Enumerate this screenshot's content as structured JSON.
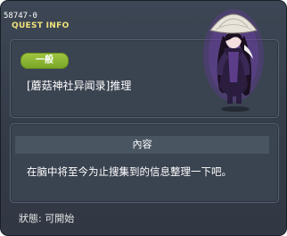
{
  "quest_id": "58747-0",
  "window_title": "QUEST INFO",
  "badge_label": "一般",
  "quest_name": "[蘑菇神社异闻录]推理",
  "content_header": "內容",
  "content_text": "在脑中将至今为止搜集到的信息整理一下吧。",
  "status_text": "狀態:  可開始",
  "colors": {
    "window_bg": "#363e4a",
    "panel_bg": "#3a4350",
    "title_yellow": "#f0e27a",
    "badge_green": "#8cb835"
  },
  "icons": {
    "npc": "robed-ninja-character"
  }
}
